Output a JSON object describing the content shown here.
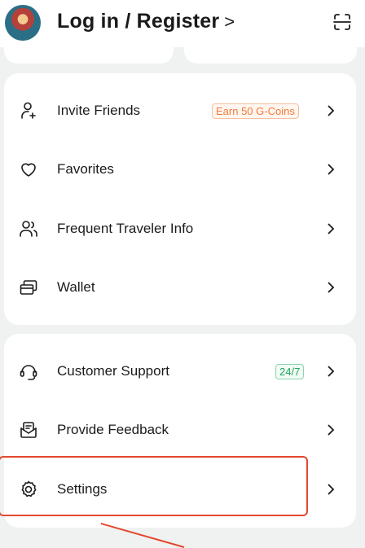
{
  "header": {
    "login_label": "Log in / Register",
    "login_chevron": ">",
    "avatar": "avatar",
    "scan_icon": "scan-icon"
  },
  "card1": {
    "items": [
      {
        "label": "Invite Friends",
        "icon": "add-user-icon",
        "badge": "Earn 50 G-Coins"
      },
      {
        "label": "Favorites",
        "icon": "heart-icon"
      },
      {
        "label": "Frequent Traveler Info",
        "icon": "travelers-icon"
      },
      {
        "label": "Wallet",
        "icon": "wallet-icon"
      }
    ]
  },
  "card2": {
    "items": [
      {
        "label": "Customer Support",
        "icon": "headset-icon",
        "badge": "24/7"
      },
      {
        "label": "Provide Feedback",
        "icon": "feedback-icon"
      },
      {
        "label": "Settings",
        "icon": "gear-icon"
      }
    ]
  },
  "colors": {
    "background": "#eff2f1",
    "badge_orange": "#f07c3c",
    "badge_green": "#22a55f",
    "annotation_red": "#e3482f"
  }
}
